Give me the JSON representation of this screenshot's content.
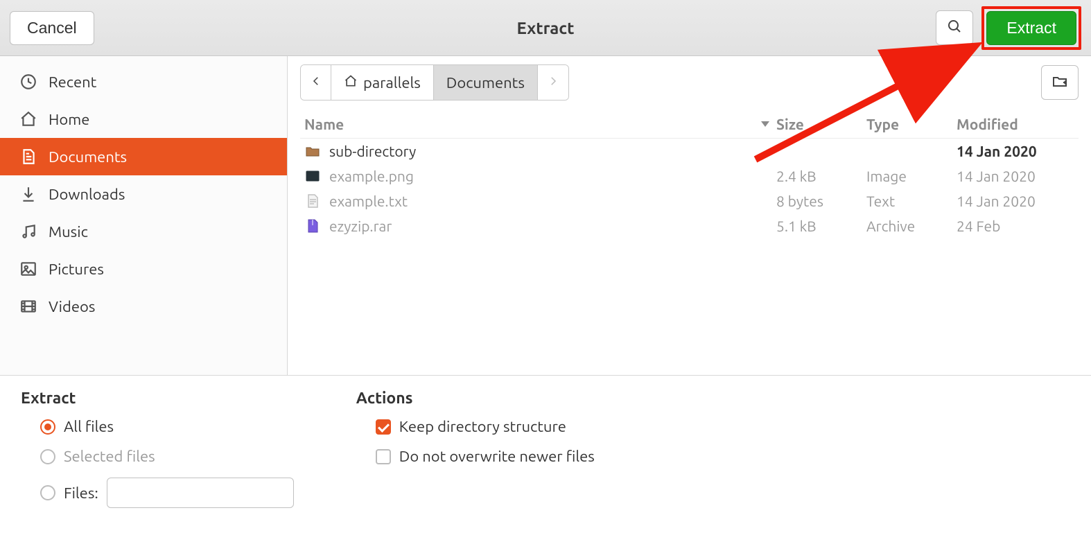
{
  "header": {
    "cancel_label": "Cancel",
    "title": "Extract",
    "extract_label": "Extract"
  },
  "sidebar": {
    "items": [
      {
        "label": "Recent",
        "key": "recent"
      },
      {
        "label": "Home",
        "key": "home"
      },
      {
        "label": "Documents",
        "key": "documents",
        "active": true
      },
      {
        "label": "Downloads",
        "key": "downloads"
      },
      {
        "label": "Music",
        "key": "music"
      },
      {
        "label": "Pictures",
        "key": "pictures"
      },
      {
        "label": "Videos",
        "key": "videos"
      }
    ]
  },
  "breadcrumb": {
    "segments": [
      {
        "label": "parallels",
        "home": true
      },
      {
        "label": "Documents",
        "current": true
      }
    ]
  },
  "columns": {
    "name": "Name",
    "size": "Size",
    "type": "Type",
    "modified": "Modified"
  },
  "files": [
    {
      "name": "sub-directory",
      "size": "",
      "type": "",
      "modified": "14 Jan 2020",
      "icon": "folder",
      "dim": false
    },
    {
      "name": "example.png",
      "size": "2.4 kB",
      "type": "Image",
      "modified": "14 Jan 2020",
      "icon": "image",
      "dim": true
    },
    {
      "name": "example.txt",
      "size": "8 bytes",
      "type": "Text",
      "modified": "14 Jan 2020",
      "icon": "text",
      "dim": true
    },
    {
      "name": "ezyzip.rar",
      "size": "5.1 kB",
      "type": "Archive",
      "modified": "24 Feb",
      "icon": "archive",
      "dim": true
    }
  ],
  "extract_panel": {
    "heading": "Extract",
    "all_files": "All files",
    "selected_files": "Selected files",
    "files_label": "Files:"
  },
  "actions_panel": {
    "heading": "Actions",
    "keep_structure": "Keep directory structure",
    "no_overwrite": "Do not overwrite newer files"
  }
}
